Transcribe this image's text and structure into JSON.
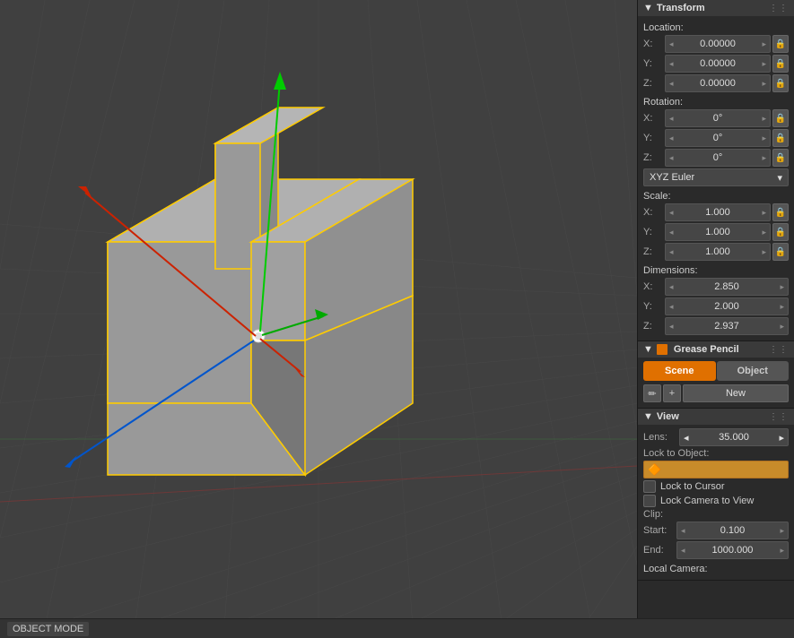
{
  "viewport": {
    "label": "3D Viewport"
  },
  "transform": {
    "title": "Transform",
    "location": {
      "label": "Location:",
      "x_label": "X:",
      "x_value": "0.00000",
      "y_label": "Y:",
      "y_value": "0.00000",
      "z_label": "Z:",
      "z_value": "0.00000"
    },
    "rotation": {
      "label": "Rotation:",
      "x_label": "X:",
      "x_value": "0°",
      "y_label": "Y:",
      "y_value": "0°",
      "z_label": "Z:",
      "z_value": "0°",
      "mode": "XYZ Euler"
    },
    "scale": {
      "label": "Scale:",
      "x_label": "X:",
      "x_value": "1.000",
      "y_label": "Y:",
      "y_value": "1.000",
      "z_label": "Z:",
      "z_value": "1.000"
    },
    "dimensions": {
      "label": "Dimensions:",
      "x_label": "X:",
      "x_value": "2.850",
      "y_label": "Y:",
      "y_value": "2.000",
      "z_label": "Z:",
      "z_value": "2.937"
    }
  },
  "grease_pencil": {
    "title": "Grease Pencil",
    "tab_scene": "Scene",
    "tab_object": "Object",
    "new_label": "New"
  },
  "view": {
    "title": "View",
    "lens_label": "Lens:",
    "lens_value": "35.000",
    "lock_object_label": "Lock to Object:",
    "lock_cursor_label": "Lock to Cursor",
    "lock_camera_label": "Lock Camera to View",
    "clip_label": "Clip:",
    "start_label": "Start:",
    "start_value": "0.100",
    "end_label": "End:",
    "end_value": "1000.000",
    "local_camera_label": "Local Camera:"
  },
  "statusbar": {
    "items": []
  },
  "icons": {
    "triangle_down": "▼",
    "triangle_right": "▶",
    "pencil": "✏",
    "plus": "+",
    "lock": "🔒",
    "dots": "⋮⋮"
  }
}
